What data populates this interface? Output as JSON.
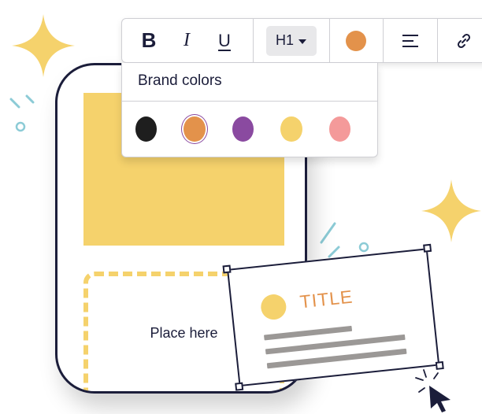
{
  "toolbar": {
    "bold_label": "B",
    "italic_label": "I",
    "underline_label": "U",
    "heading_value": "H1",
    "current_color": "#e3924b",
    "icons": [
      "bold-icon",
      "italic-icon",
      "underline-icon",
      "chevron-down-icon",
      "align-icon",
      "link-icon"
    ]
  },
  "color_menu": {
    "title": "Brand colors",
    "swatches": [
      {
        "color": "#1e1e1e"
      },
      {
        "color": "#e3924b",
        "selected": true
      },
      {
        "color": "#8a4aa0"
      },
      {
        "color": "#f5d26c"
      },
      {
        "color": "#f49a9a"
      }
    ]
  },
  "device": {
    "hero_color": "#f5d26c",
    "dropzone_label": "Place here"
  },
  "title_card": {
    "title": "TITLE",
    "title_color": "#e3924b",
    "dot_color": "#f5d26c",
    "line_color": "#9b9896"
  },
  "colors": {
    "ink": "#1b1d3a",
    "sparkle": "#f5d26c",
    "accent_teal": "#8ccbd6"
  }
}
